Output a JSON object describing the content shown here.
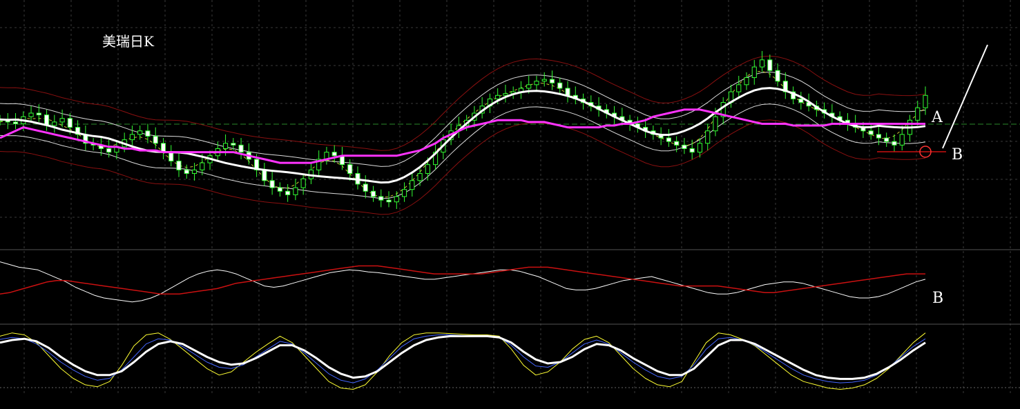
{
  "title": "美瑞日K",
  "annotations": {
    "label_a": "A",
    "label_b_main": "B",
    "label_b_osc": "B"
  },
  "colors": {
    "background": "#000000",
    "grid": "#3a3a3a",
    "candle": "#33ff33",
    "ma_slow": "#ff33ff",
    "ma_mid": "#ffffff",
    "band": "#8b1010",
    "osc_line": "#ffffff",
    "osc_signal": "#cc1111",
    "stoch_k": "#ffff33",
    "stoch_d": "#4466ff",
    "stoch_slow": "#ffffff"
  },
  "chart_data": [
    {
      "type": "candlestick",
      "title": "美瑞日K",
      "series": [
        {
          "name": "",
          "kind": "candles",
          "close": [
            58,
            57,
            56,
            60,
            62,
            61,
            55,
            57,
            59,
            54,
            50,
            45,
            44,
            42,
            40,
            43,
            47,
            50,
            52,
            49,
            45,
            40,
            35,
            30,
            28,
            30,
            34,
            38,
            42,
            45,
            44,
            40,
            36,
            30,
            24,
            20,
            18,
            16,
            20,
            25,
            30,
            36,
            40,
            38,
            33,
            28,
            22,
            18,
            15,
            13,
            12,
            15,
            19,
            24,
            28,
            33,
            40,
            47,
            52,
            55,
            58,
            62,
            66,
            70,
            72,
            73,
            74,
            76,
            78,
            80,
            81,
            79,
            76,
            72,
            70,
            68,
            66,
            64,
            62,
            60,
            58,
            56,
            54,
            52,
            50,
            48,
            46,
            44,
            42,
            40,
            45,
            52,
            60,
            68,
            74,
            78,
            82,
            88,
            92,
            86,
            80,
            74,
            70,
            68,
            66,
            64,
            62,
            60,
            58,
            56,
            54,
            52,
            50,
            48,
            46,
            44,
            50,
            58,
            65,
            72
          ]
        }
      ],
      "moving_averages": [
        {
          "name": "",
          "values": [
            48,
            50,
            52,
            54,
            53,
            52,
            51,
            50,
            49,
            48,
            47,
            46,
            45,
            44,
            43,
            43,
            42,
            42,
            41,
            41,
            41,
            40,
            40,
            40,
            40,
            40,
            40,
            40,
            40,
            40,
            40,
            39,
            38,
            37,
            36,
            35,
            34,
            34,
            34,
            34,
            34,
            35,
            36,
            37,
            38,
            38,
            38,
            38,
            38,
            38,
            38,
            38,
            39,
            40,
            41,
            43,
            45,
            48,
            50,
            52,
            54,
            55,
            56,
            57,
            58,
            58,
            58,
            58,
            57,
            57,
            57,
            56,
            55,
            54,
            54,
            54,
            54,
            54,
            55,
            55,
            56,
            56,
            57,
            58,
            60,
            61,
            62,
            63,
            64,
            64,
            64,
            63,
            62,
            61,
            60,
            59,
            58,
            57,
            56,
            56,
            56,
            56,
            55,
            55,
            55,
            55,
            55,
            56,
            56,
            56,
            56,
            56,
            56,
            56,
            56,
            56,
            56,
            56,
            56,
            56
          ]
        }
      ]
    },
    {
      "type": "line",
      "series": [
        {
          "name": "",
          "values": [
            88,
            84,
            80,
            78,
            76,
            70,
            64,
            58,
            50,
            44,
            38,
            34,
            32,
            30,
            28,
            30,
            34,
            40,
            48,
            56,
            64,
            70,
            74,
            76,
            74,
            70,
            64,
            58,
            52,
            50,
            52,
            56,
            60,
            64,
            68,
            72,
            74,
            76,
            75,
            73,
            72,
            70,
            68,
            66,
            64,
            62,
            62,
            64,
            66,
            68,
            70,
            72,
            74,
            76,
            76,
            74,
            70,
            66,
            60,
            54,
            48,
            46,
            46,
            48,
            52,
            56,
            60,
            62,
            64,
            66,
            62,
            58,
            54,
            50,
            46,
            42,
            40,
            40,
            42,
            46,
            50,
            54,
            56,
            58,
            58,
            56,
            52,
            48,
            44,
            40,
            36,
            34,
            34,
            36,
            40,
            46,
            52,
            58,
            62
          ]
        },
        {
          "name": "",
          "values": [
            40,
            42,
            46,
            50,
            54,
            58,
            60,
            60,
            58,
            56,
            54,
            52,
            50,
            48,
            46,
            44,
            42,
            40,
            40,
            40,
            42,
            44,
            46,
            48,
            52,
            56,
            58,
            60,
            62,
            64,
            66,
            68,
            70,
            72,
            74,
            76,
            78,
            80,
            82,
            82,
            82,
            80,
            78,
            76,
            74,
            72,
            70,
            70,
            70,
            70,
            70,
            70,
            72,
            74,
            76,
            78,
            80,
            80,
            80,
            78,
            76,
            74,
            72,
            70,
            68,
            66,
            64,
            62,
            60,
            58,
            56,
            54,
            52,
            52,
            52,
            52,
            52,
            50,
            48,
            46,
            44,
            42,
            42,
            44,
            46,
            48,
            50,
            52,
            54,
            56,
            58,
            60,
            62,
            64,
            66,
            68,
            70,
            70,
            70
          ]
        }
      ]
    },
    {
      "type": "line",
      "series": [
        {
          "name": "",
          "values": [
            90,
            95,
            92,
            80,
            60,
            40,
            25,
            15,
            12,
            20,
            45,
            75,
            92,
            95,
            85,
            70,
            55,
            40,
            30,
            35,
            50,
            65,
            78,
            90,
            80,
            60,
            40,
            20,
            10,
            8,
            15,
            35,
            60,
            80,
            92,
            95,
            95,
            94,
            93,
            92,
            92,
            90,
            70,
            45,
            30,
            35,
            50,
            70,
            85,
            90,
            80,
            60,
            40,
            25,
            15,
            12,
            20,
            50,
            80,
            95,
            92,
            85,
            75,
            60,
            45,
            30,
            20,
            15,
            10,
            8,
            10,
            15,
            25,
            40,
            60,
            80,
            95
          ]
        },
        {
          "name": "",
          "values": [
            85,
            88,
            86,
            78,
            65,
            50,
            38,
            28,
            22,
            25,
            38,
            58,
            78,
            86,
            84,
            74,
            62,
            50,
            42,
            40,
            46,
            58,
            70,
            82,
            78,
            64,
            48,
            32,
            22,
            18,
            24,
            38,
            56,
            74,
            86,
            90,
            92,
            92,
            91,
            90,
            90,
            88,
            76,
            58,
            44,
            42,
            50,
            64,
            78,
            84,
            78,
            64,
            50,
            38,
            28,
            24,
            28,
            46,
            70,
            86,
            88,
            84,
            76,
            64,
            52,
            40,
            30,
            24,
            20,
            18,
            19,
            22,
            30,
            42,
            58,
            74,
            86
          ]
        },
        {
          "name": "",
          "values": [
            80,
            84,
            86,
            82,
            72,
            58,
            46,
            36,
            30,
            30,
            36,
            50,
            66,
            78,
            82,
            78,
            68,
            58,
            50,
            46,
            48,
            56,
            66,
            76,
            76,
            68,
            56,
            42,
            32,
            26,
            28,
            36,
            50,
            64,
            76,
            84,
            88,
            90,
            90,
            90,
            90,
            88,
            80,
            66,
            54,
            48,
            50,
            58,
            70,
            78,
            76,
            68,
            56,
            46,
            36,
            30,
            30,
            40,
            58,
            76,
            84,
            84,
            78,
            68,
            58,
            48,
            38,
            30,
            26,
            24,
            24,
            26,
            32,
            42,
            54,
            68,
            80
          ]
        }
      ]
    }
  ]
}
